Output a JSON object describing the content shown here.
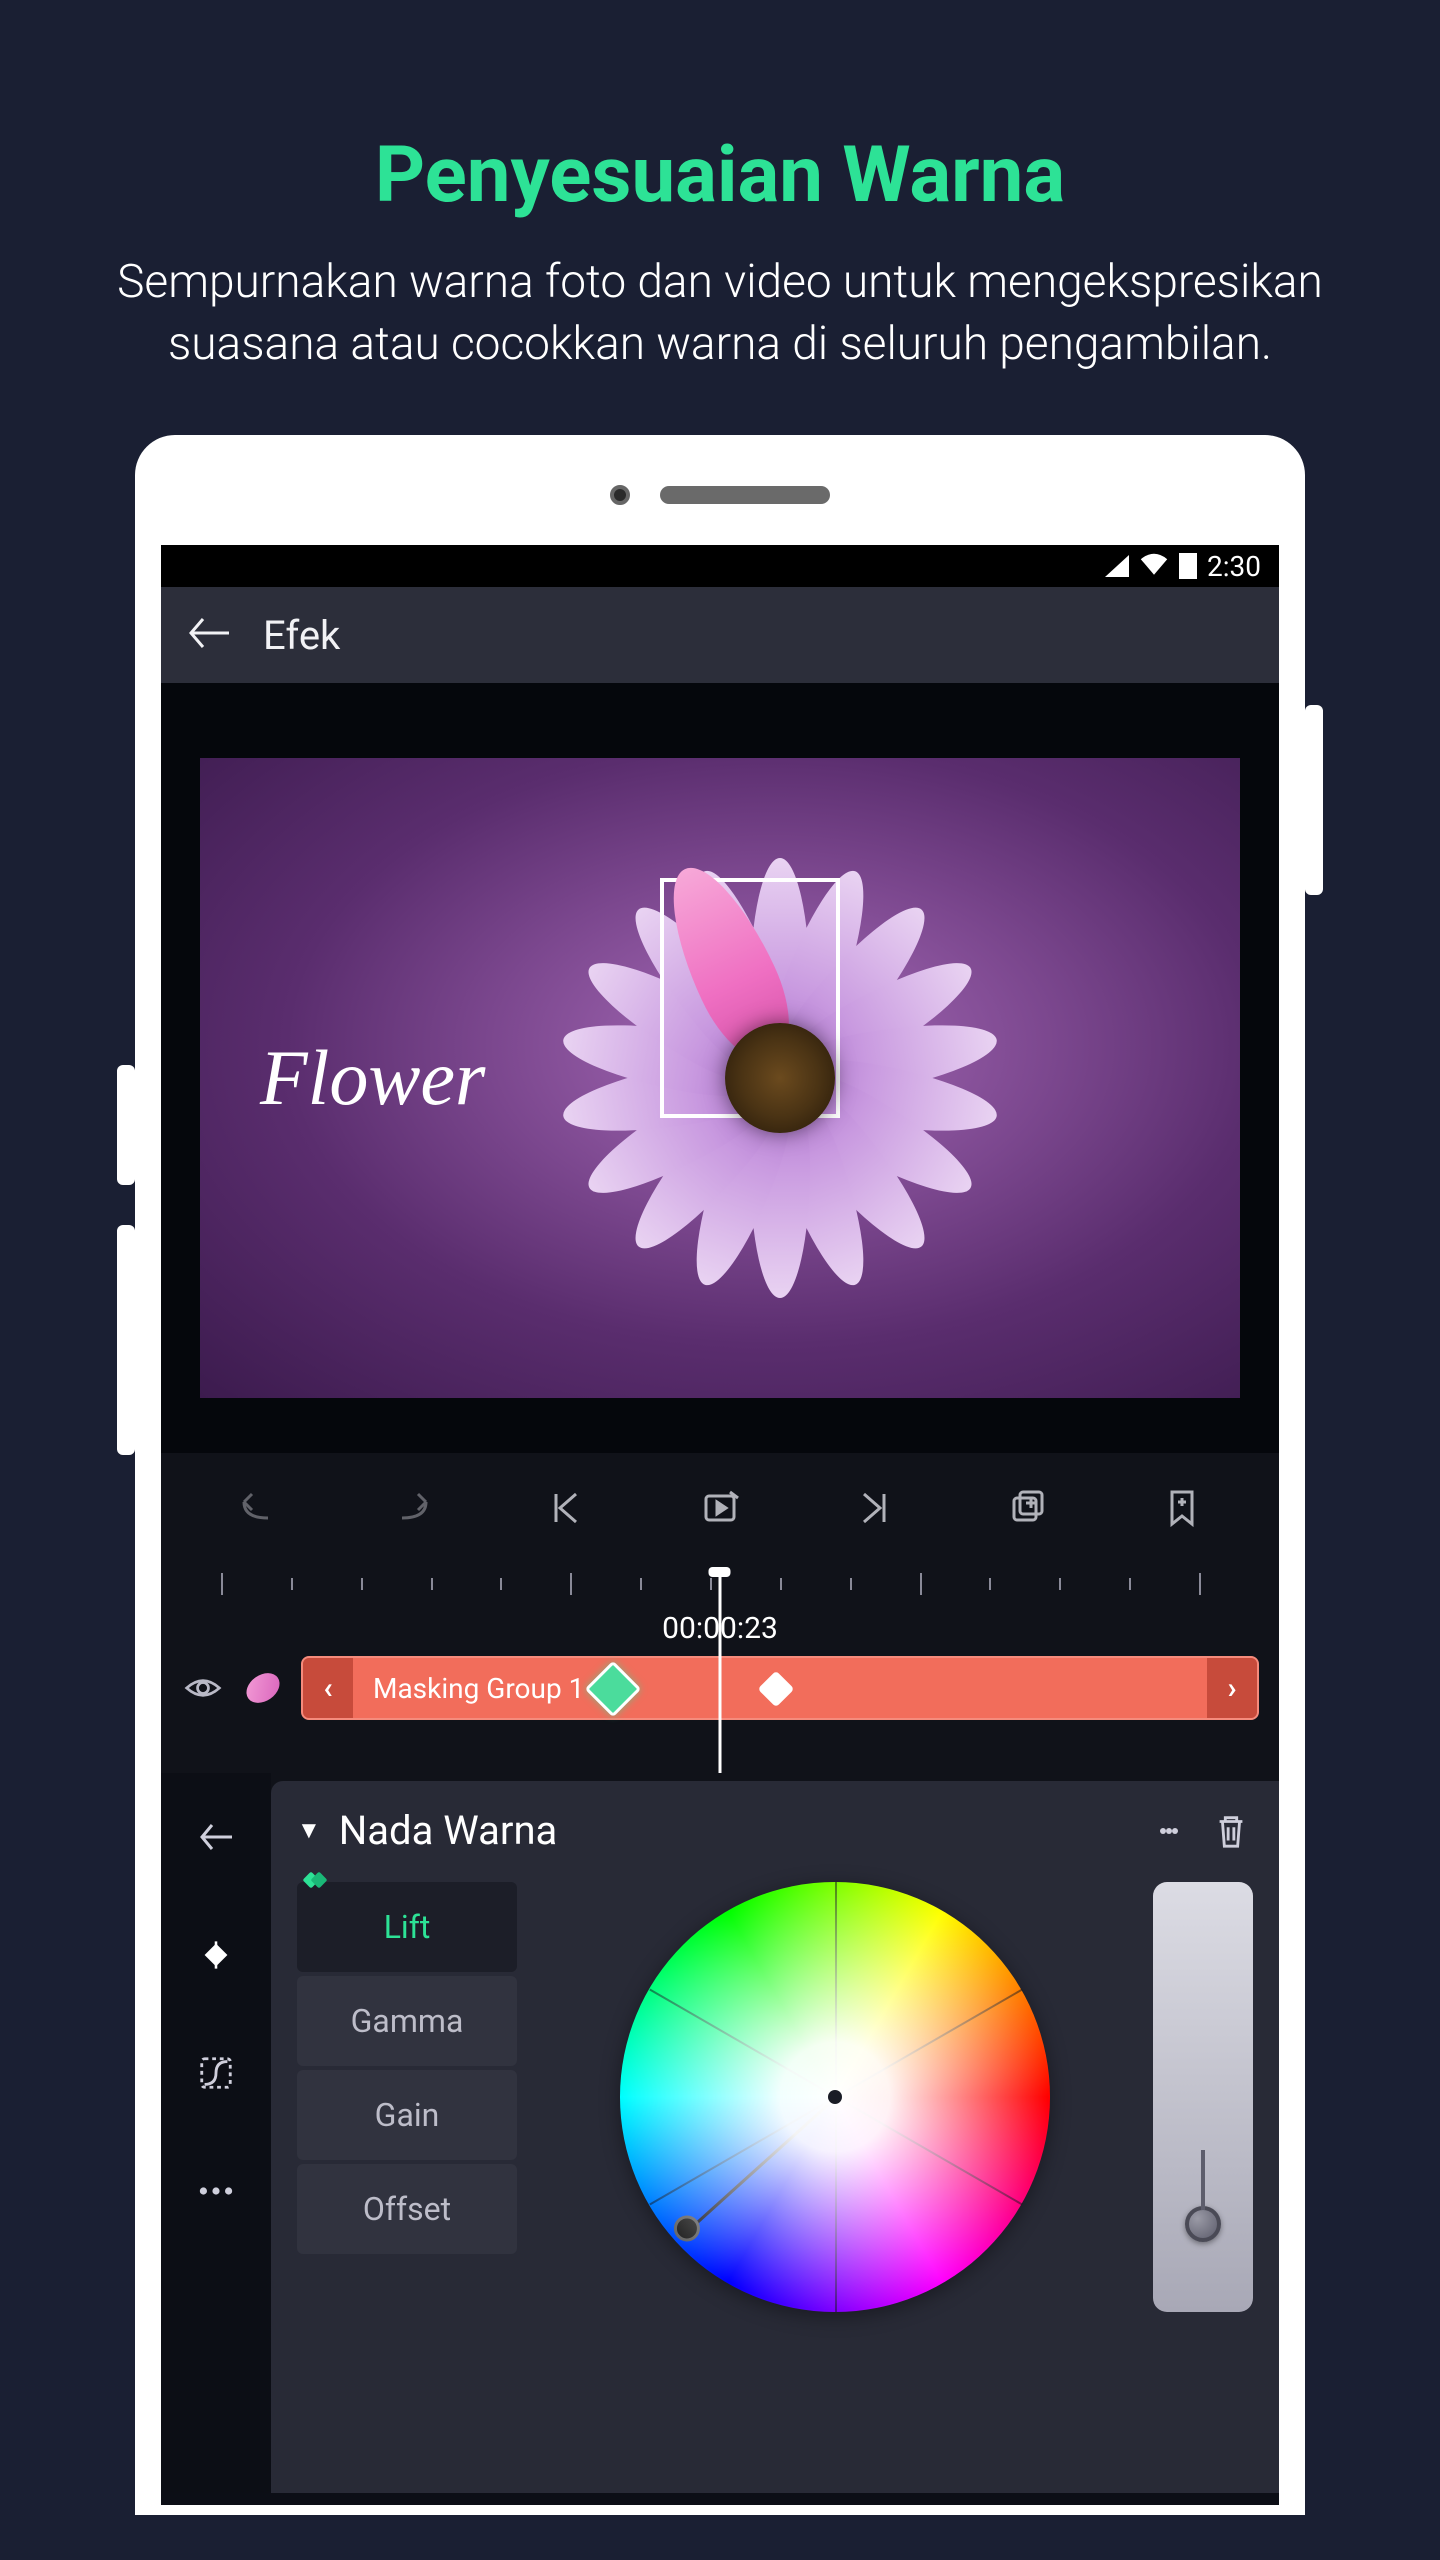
{
  "promo": {
    "title": "Penyesuaian Warna",
    "description": "Sempurnakan warna foto dan video untuk mengekspresikan suasana atau cocokkan warna di seluruh pengambilan."
  },
  "statusbar": {
    "time": "2:30"
  },
  "header": {
    "title": "Efek"
  },
  "preview": {
    "text_overlay": "Flower"
  },
  "timeline": {
    "timecode": "00:00:23",
    "clip_label": "Masking Group 1"
  },
  "panel": {
    "title": "Nada Warna",
    "tabs": {
      "lift": "Lift",
      "gamma": "Gamma",
      "gain": "Gain",
      "offset": "Offset"
    }
  }
}
